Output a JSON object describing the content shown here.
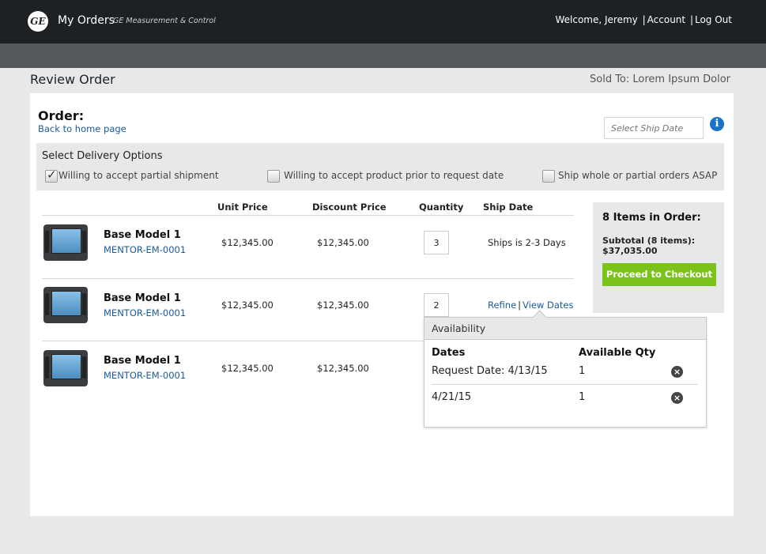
{
  "header": {
    "logo_text": "GE",
    "app_title": "My Orders",
    "app_subtitle": "GE Measurement & Control",
    "welcome": "Welcome, Jeremy",
    "sep": "|",
    "account": "Account",
    "logout": "Log Out"
  },
  "page": {
    "title": "Review Order",
    "sold_to": "Sold To: Lorem Ipsum Dolor"
  },
  "order": {
    "heading": "Order:",
    "back_link": "Back to home page",
    "ship_date_placeholder": "Select Ship Date",
    "info_icon": "i"
  },
  "delivery": {
    "title": "Select Delivery Options",
    "options": [
      {
        "label": "Willing to accept partial shipment",
        "checked": true
      },
      {
        "label": "Willing to accept product prior to request date",
        "checked": false
      },
      {
        "label": "Ship whole or partial orders ASAP",
        "checked": false
      }
    ]
  },
  "table": {
    "headers": [
      "Unit Price",
      "Discount Price",
      "Quantity",
      "Ship Date"
    ],
    "rows": [
      {
        "name": "Base Model 1",
        "sku": "MENTOR-EM-0001",
        "unit_price": "$12,345.00",
        "discount_price": "$12,345.00",
        "qty": "3",
        "ship": "Ships is 2-3 Days"
      },
      {
        "name": "Base Model 1",
        "sku": "MENTOR-EM-0001",
        "unit_price": "$12,345.00",
        "discount_price": "$12,345.00",
        "qty": "2",
        "refine": "Refine",
        "sep": "|",
        "view_dates": "View Dates"
      },
      {
        "name": "Base Model 1",
        "sku": "MENTOR-EM-0001",
        "unit_price": "$12,345.00",
        "discount_price": "$12,345.00"
      }
    ]
  },
  "summary": {
    "title": "8 Items in Order:",
    "subtotal": "Subtotal (8 items): $37,035.00",
    "checkout": "Proceed to Checkout"
  },
  "availability": {
    "title": "Availability",
    "col_dates": "Dates",
    "col_qty": "Available Qty",
    "rows": [
      {
        "date": "Request Date: 4/13/15",
        "qty": "1"
      },
      {
        "date": "4/21/15",
        "qty": "1"
      }
    ],
    "remove_icon": "×"
  },
  "colors": {
    "header_bg": "#1e2124",
    "subbar_bg": "#55585c",
    "accent_green": "#7bc31b",
    "link_blue": "#1a5a9a",
    "info_blue": "#1a73c5"
  }
}
